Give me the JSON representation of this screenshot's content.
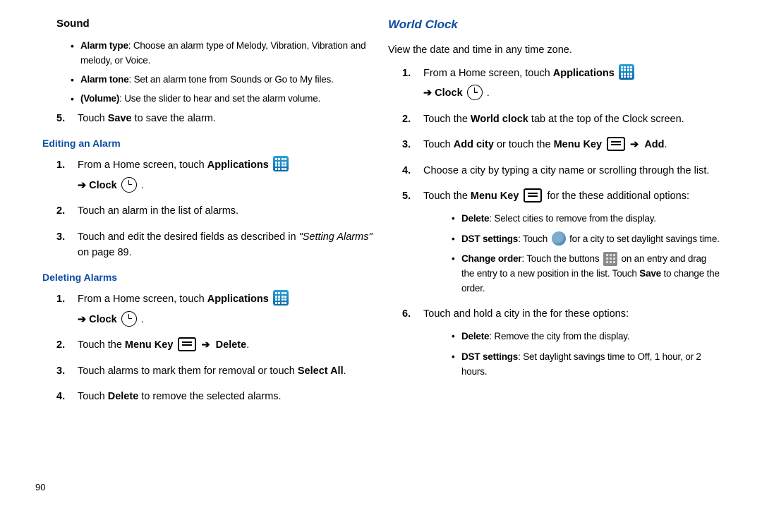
{
  "left": {
    "sound_heading": "Sound",
    "bullets": {
      "alarm_type_label": "Alarm type",
      "alarm_type_text": ": Choose an alarm type of Melody, Vibration, Vibration and melody, or Voice.",
      "alarm_tone_label": "Alarm tone",
      "alarm_tone_text": ": Set an alarm tone from Sounds or Go to My files.",
      "volume_label": "(Volume)",
      "volume_text": ": Use the slider to hear and set the alarm volume."
    },
    "step5_pre": "Touch ",
    "step5_bold": "Save",
    "step5_post": " to save the alarm.",
    "editing_heading": "Editing an Alarm",
    "edit": {
      "s1_pre": "From a Home screen, touch ",
      "s1_apps": "Applications",
      "s1_clock": "Clock",
      "s2": "Touch an alarm in the list of alarms.",
      "s3_pre": "Touch and edit the desired fields as described in ",
      "s3_italic": "\"Setting Alarms\"",
      "s3_post": " on page 89."
    },
    "deleting_heading": "Deleting Alarms",
    "del": {
      "s1_pre": "From a Home screen, touch ",
      "s1_apps": "Applications",
      "s1_clock": "Clock",
      "s2_pre": "Touch the ",
      "s2_menu": "Menu Key",
      "s2_delete": "Delete",
      "s3_pre": "Touch alarms to mark them for removal or touch ",
      "s3_bold": "Select All",
      "s4_pre": "Touch ",
      "s4_bold": "Delete",
      "s4_post": " to remove the selected alarms."
    }
  },
  "right": {
    "world_heading": "World Clock",
    "intro": "View the date and time in any time zone.",
    "s1_pre": "From a Home screen, touch ",
    "s1_apps": "Applications",
    "s1_clock": "Clock",
    "s2_pre": "Touch the ",
    "s2_bold": "World clock",
    "s2_post": " tab at the top of the Clock screen.",
    "s3_pre": "Touch ",
    "s3_addcity": "Add city",
    "s3_mid": " or touch the ",
    "s3_menu": "Menu Key",
    "s3_add": "Add",
    "s4": "Choose a city by typing a city name or scrolling through the list.",
    "s5_pre": "Touch the ",
    "s5_menu": "Menu Key",
    "s5_post": " for the these additional options:",
    "s5b": {
      "del_label": "Delete",
      "del_text": ": Select cities to remove from the display.",
      "dst_label": "DST settings",
      "dst_pre": ": Touch ",
      "dst_post": " for a city to set daylight savings time.",
      "chg_label": "Change order",
      "chg_pre": ": Touch the buttons ",
      "chg_mid": " on an entry and drag the entry to a new position in the list. Touch ",
      "chg_save": "Save",
      "chg_post": " to change the order."
    },
    "s6": "Touch and hold a city in the for these options:",
    "s6b": {
      "del_label": "Delete",
      "del_text": ": Remove the city from the display.",
      "dst_label": "DST settings",
      "dst_text": ": Set daylight savings time to Off, 1 hour, or 2 hours."
    }
  },
  "pagenum": "90",
  "arrow": "➔"
}
